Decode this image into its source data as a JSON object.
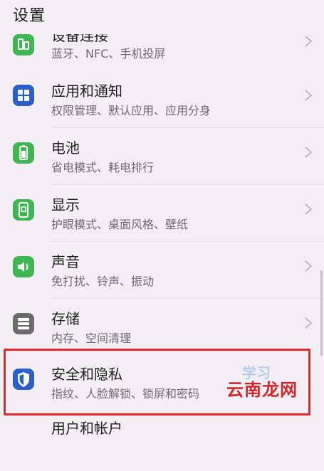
{
  "header": {
    "title": "设置"
  },
  "items": [
    {
      "title": "设备连接",
      "subtitle": "蓝牙、NFC、手机投屏",
      "icon": "device-connection-icon"
    },
    {
      "title": "应用和通知",
      "subtitle": "权限管理、默认应用、应用分身",
      "icon": "apps-icon"
    },
    {
      "title": "电池",
      "subtitle": "省电模式、耗电排行",
      "icon": "battery-icon"
    },
    {
      "title": "显示",
      "subtitle": "护眼模式、桌面风格、壁纸",
      "icon": "display-icon"
    },
    {
      "title": "声音",
      "subtitle": "免打扰、铃声、振动",
      "icon": "sound-icon"
    },
    {
      "title": "存储",
      "subtitle": "内存、空间清理",
      "icon": "storage-icon"
    },
    {
      "title": "安全和隐私",
      "subtitle": "指纹、人脸解锁、锁屏和密码",
      "icon": "shield-icon"
    },
    {
      "title": "用户和帐户",
      "subtitle": "",
      "icon": "user-icon"
    }
  ],
  "watermark": {
    "text": "云南龙网",
    "faint": "学习"
  },
  "colors": {
    "background": "#f3eef3",
    "green_icon": "#3fb653",
    "blue_icon": "#2a5fc9",
    "gray_icon": "#6b6b6b",
    "highlight": "#e6262b"
  }
}
